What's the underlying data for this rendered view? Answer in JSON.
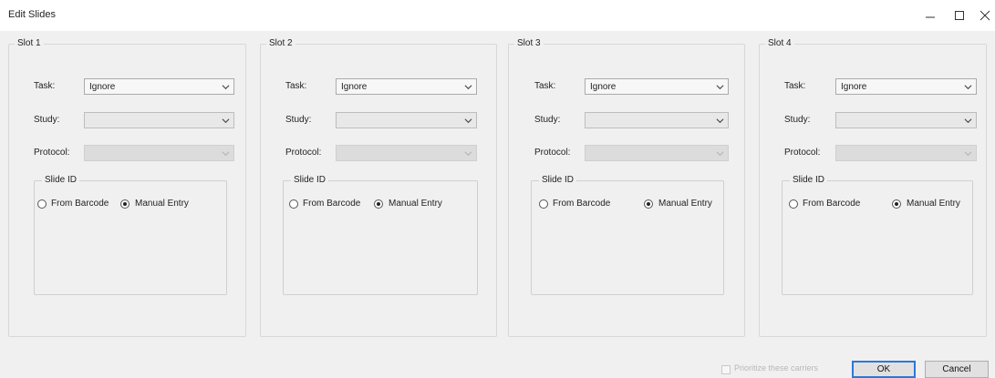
{
  "window": {
    "title": "Edit Slides",
    "controls": {
      "minimize_icon": "minimize-icon",
      "maximize_icon": "maximize-icon",
      "close_icon": "close-icon"
    }
  },
  "labels": {
    "task": "Task:",
    "study": "Study:",
    "protocol": "Protocol:",
    "slide_id": "Slide ID",
    "from_barcode": "From Barcode",
    "manual_entry": "Manual Entry"
  },
  "slots": [
    {
      "title": "Slot 1",
      "task": "Ignore",
      "study": "",
      "protocol": "",
      "slide_id_mode": "Manual Entry"
    },
    {
      "title": "Slot 2",
      "task": "Ignore",
      "study": "",
      "protocol": "",
      "slide_id_mode": "Manual Entry"
    },
    {
      "title": "Slot 3",
      "task": "Ignore",
      "study": "",
      "protocol": "",
      "slide_id_mode": "Manual Entry"
    },
    {
      "title": "Slot 4",
      "task": "Ignore",
      "study": "",
      "protocol": "",
      "slide_id_mode": "Manual Entry"
    }
  ],
  "footer": {
    "prioritize_label": "Prioritize these carriers",
    "prioritize_checked": false,
    "ok_label": "OK",
    "cancel_label": "Cancel"
  },
  "colors": {
    "focus_accent": "#2b79d6"
  }
}
